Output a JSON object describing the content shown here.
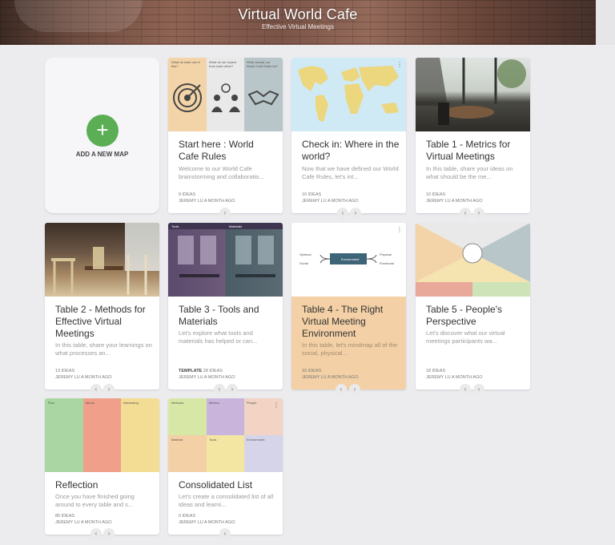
{
  "header": {
    "title": "Virtual World Cafe",
    "subtitle": "Effective Virtual Meetings"
  },
  "add_card": {
    "label": "ADD A NEW MAP",
    "plus": "+"
  },
  "cards": [
    {
      "title": "Start here : World Cafe Rules",
      "desc": "Welcome to our World Cafe brainstorming and collaboratio...",
      "count": "9 IDEAS",
      "author": "JEREMY LU A MONTH AGO",
      "thumb_headers": [
        "What do want out of this?",
        "What do we expect from each other?",
        "What should our World Cafe Rules be?"
      ]
    },
    {
      "title": "Check in: Where in the world?",
      "desc": "Now that we have defined our World Cafe Rules, let's int...",
      "count": "10 IDEAS",
      "author": "JEREMY LU A MONTH AGO"
    },
    {
      "title": "Table 1 - Metrics for Virtual Meetings",
      "desc": "In this table, share your ideas on what should be the me...",
      "count": "10 IDEAS",
      "author": "JEREMY LU A MONTH AGO"
    },
    {
      "title": "Table 2 - Methods for Effective Virtual Meetings",
      "desc": "In this table, share your learnings on what processes an...",
      "count": "13 IDEAS",
      "author": "JEREMY LU A MONTH AGO"
    },
    {
      "title": "Table 3 - Tools and Materials",
      "desc": "Let's explore what tools and materials has helped or can...",
      "template": "TEMPLATE",
      "count": "28 IDEAS",
      "author": "JEREMY LU A MONTH AGO",
      "thumb_headers": [
        "Tools",
        "Materials"
      ]
    },
    {
      "title": "Table 4 - The Right Virtual Meeting Environment",
      "desc": "In this table, let's mindmap all of the social, physical...",
      "count": "33 IDEAS",
      "author": "JEREMY LU A MONTH AGO",
      "thumb_center": "Environment",
      "thumb_left": [
        "Spiritual",
        "Social"
      ],
      "thumb_right": [
        "Physical",
        "Emotional"
      ]
    },
    {
      "title": "Table 5 - People's Perspective",
      "desc": "Let's discover what our virtual meetings participants wa...",
      "count": "18 IDEAS",
      "author": "JEREMY LU A MONTH AGO"
    },
    {
      "title": "Reflection",
      "desc": "Once you have finished going around to every table and s...",
      "count": "80 IDEAS",
      "author": "JEREMY LU A MONTH AGO",
      "thumb_headers": [
        "Plus",
        "Minus",
        "Interesting"
      ]
    },
    {
      "title": "Consolidated List",
      "desc": "Let's create a consolidated list of all ideas and learni...",
      "count": "0 IDEAS",
      "author": "JEREMY LU A MONTH AGO",
      "thumb_headers": [
        "Methods",
        "Metrics",
        "People",
        "Material",
        "Tools",
        "Environment"
      ]
    }
  ],
  "nav": {
    "prev": "‹",
    "next": "›"
  },
  "colors": {
    "accent_green": "#5cae55",
    "peach": "#f3d4a8",
    "grey": "#e9e9ea",
    "teal_grey": "#b9c6c9",
    "sky": "#cfe9f5",
    "map_land": "#ecd67e"
  }
}
